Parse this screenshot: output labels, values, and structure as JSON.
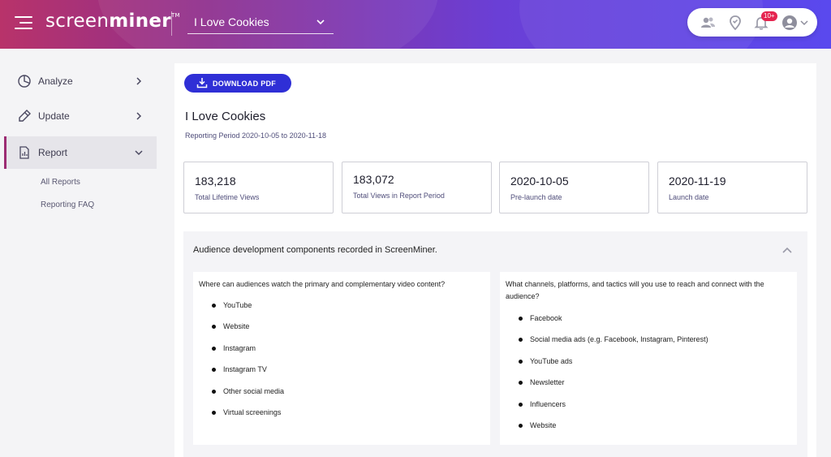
{
  "header": {
    "logo_light": "screen",
    "logo_bold": "miner",
    "logo_tm": "TM",
    "project": "I Love Cookies",
    "notification_count": "10+"
  },
  "sidebar": {
    "items": [
      {
        "label": "Analyze"
      },
      {
        "label": "Update"
      },
      {
        "label": "Report"
      }
    ],
    "subitems": [
      {
        "label": "All Reports"
      },
      {
        "label": "Reporting FAQ"
      }
    ]
  },
  "main": {
    "download_label": "DOWNLOAD PDF",
    "title": "I Love Cookies",
    "period": "Reporting Period 2020-10-05 to 2020-11-18",
    "stats": [
      {
        "value": "183,218",
        "label": "Total Lifetime Views"
      },
      {
        "value": "183,072",
        "label": "Total Views in Report Period"
      },
      {
        "value": "2020-10-05",
        "label": "Pre-launch date"
      },
      {
        "value": "2020-11-19",
        "label": "Launch date"
      }
    ],
    "audience": {
      "heading": "Audience development components recorded in ScreenMiner.",
      "left": {
        "question": "Where can audiences watch the primary and complementary video content?",
        "items": [
          "YouTube",
          "Website",
          "Instagram",
          "Instagram TV",
          "Other social media",
          "Virtual screenings"
        ]
      },
      "right": {
        "question_line1": "What channels, platforms, and tactics will you use to reach and connect with the",
        "question_line2": "audience?",
        "items": [
          "Facebook",
          "Social media ads (e.g. Facebook, Instagram, Pinterest)",
          "YouTube ads",
          "Newsletter",
          "Influencers",
          "Website"
        ]
      }
    }
  },
  "colors": {
    "accent_blue": "#2f2fd6",
    "active_border": "#9c2c73",
    "badge": "#e5244f"
  }
}
